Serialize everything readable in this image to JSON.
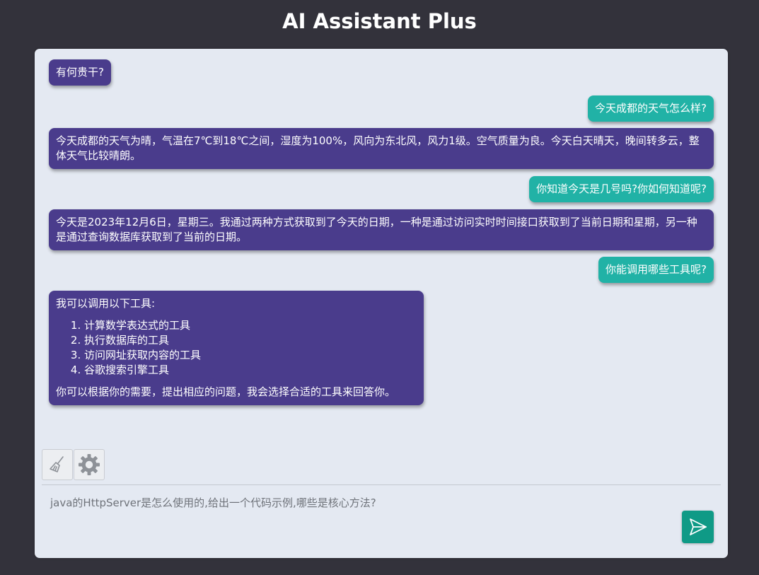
{
  "app": {
    "title": "AI Assistant Plus"
  },
  "messages": [
    {
      "role": "bot",
      "text": "有何贵干?"
    },
    {
      "role": "user",
      "text": "今天成都的天气怎么样?"
    },
    {
      "role": "bot",
      "text": "今天成都的天气为晴，气温在7℃到18℃之间，湿度为100%，风向为东北风，风力1级。空气质量为良。今天白天晴天，晚间转多云，整体天气比较晴朗。"
    },
    {
      "role": "user",
      "text": "你知道今天是几号吗?你如何知道呢?"
    },
    {
      "role": "bot",
      "text": "今天是2023年12月6日，星期三。我通过两种方式获取到了今天的日期，一种是通过访问实时时间接口获取到了当前日期和星期，另一种是通过查询数据库获取到了当前的日期。"
    },
    {
      "role": "user",
      "text": "你能调用哪些工具呢?"
    },
    {
      "role": "bot",
      "intro": "我可以调用以下工具:",
      "items": [
        "计算数学表达式的工具",
        "执行数据库的工具",
        "访问网址获取内容的工具",
        "谷歌搜索引擎工具"
      ],
      "outro": "你可以根据你的需要，提出相应的问题，我会选择合适的工具来回答你。"
    }
  ],
  "toolbar": {
    "clear_icon": "broom-icon",
    "settings_icon": "gear-icon"
  },
  "composer": {
    "placeholder": "java的HttpServer是怎么使用的,给出一个代码示例,哪些是核心方法?",
    "send_icon": "send-icon"
  },
  "colors": {
    "background": "#33323b",
    "panel": "#e4e9f2",
    "bot_bubble": "#4a3c8c",
    "user_bubble": "#21b2a6",
    "send_button": "#0f9a86"
  }
}
